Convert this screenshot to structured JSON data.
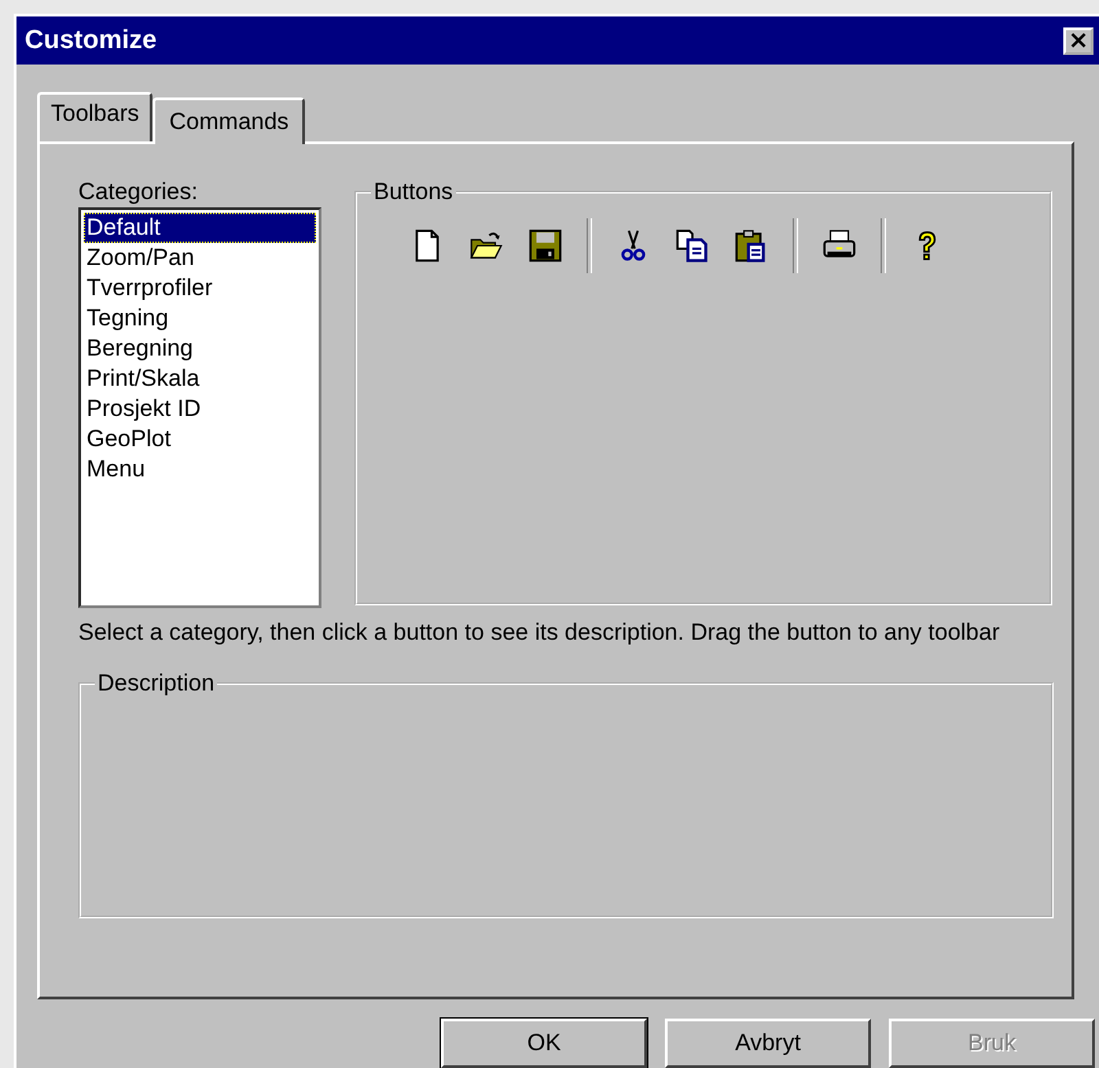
{
  "window": {
    "title": "Customize",
    "close": "×"
  },
  "tabs": [
    {
      "label": "Toolbars",
      "selected": false
    },
    {
      "label": "Commands",
      "selected": true
    }
  ],
  "categories": {
    "label": "Categories:",
    "items": [
      {
        "label": "Default",
        "selected": true
      },
      {
        "label": "Zoom/Pan",
        "selected": false
      },
      {
        "label": "Tverrprofiler",
        "selected": false
      },
      {
        "label": "Tegning",
        "selected": false
      },
      {
        "label": "Beregning",
        "selected": false
      },
      {
        "label": "Print/Skala",
        "selected": false
      },
      {
        "label": "Prosjekt ID",
        "selected": false
      },
      {
        "label": "GeoPlot",
        "selected": false
      },
      {
        "label": "Menu",
        "selected": false
      }
    ]
  },
  "buttons_group": {
    "label": "Buttons"
  },
  "instructions": "Select a category, then click a button to see its description. Drag the button to any toolbar",
  "description_group": {
    "label": "Description"
  },
  "dialog_buttons": [
    {
      "label": "OK",
      "default": true,
      "disabled": false
    },
    {
      "label": "Avbryt",
      "default": false,
      "disabled": false
    },
    {
      "label": "Bruk",
      "default": false,
      "disabled": true
    }
  ]
}
